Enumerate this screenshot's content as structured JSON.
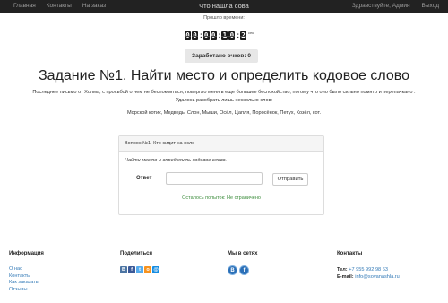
{
  "navbar": {
    "links": [
      "Главная",
      "Контакты",
      "На заказ"
    ],
    "brand": "Что нашла сова",
    "greeting": "Здравствуйте, Админ",
    "logout": "Выход"
  },
  "timer": {
    "label": "Прошло времени:",
    "digits": [
      "0",
      "0",
      "0",
      "0",
      "1",
      "0",
      "2"
    ],
    "unit": "сек"
  },
  "score": {
    "text": "Заработано очков: 0"
  },
  "task": {
    "title": "Задание №1. Найти место и определить кодовое слово",
    "intro": "Последнее письмо от Холма, с просьбой о нем не беспокоиться, повергло меня в еще большее беспокойство, потому что оно было сильно помято и перепачкано . Удалось разобрать лишь несколько слов:",
    "words": "Морской котик, Медведь, Слон, Мыши, Осёл, Цапля, Поросёнок, Петух, Козёл, кот."
  },
  "question": {
    "header": "Вопрос №1. Кто сидит на осле",
    "instruction": "Найти место и определить кодовое слово.",
    "answer_label": "Ответ",
    "answer_value": "",
    "submit_label": "Отправить",
    "attempts": "Осталось попыток: Не ограничено"
  },
  "footer": {
    "info": {
      "title": "Информация",
      "links": [
        "О нас",
        "Контакты",
        "Как заказать",
        "Отзывы"
      ]
    },
    "share": {
      "title": "Поделиться",
      "icons": [
        "vk-icon",
        "facebook-icon",
        "twitter-icon",
        "odnoklassniki-icon",
        "mail-icon"
      ]
    },
    "social": {
      "title": "Мы в сетях",
      "icons": [
        "vk-icon",
        "facebook-icon"
      ]
    },
    "contacts": {
      "title": "Контакты",
      "phone_label": "Тел:",
      "phone": "+7 955 992 98 63",
      "email_label": "E-mail:",
      "email": "info@sovanashla.ru"
    }
  },
  "colors": {
    "navbar": "#222222",
    "link": "#337ab7",
    "success": "#3c8d3c",
    "vk": "#4c75a3",
    "facebook": "#3b5998",
    "twitter": "#55acee",
    "odnoklassniki": "#f7931e",
    "mail": "#168de2"
  }
}
